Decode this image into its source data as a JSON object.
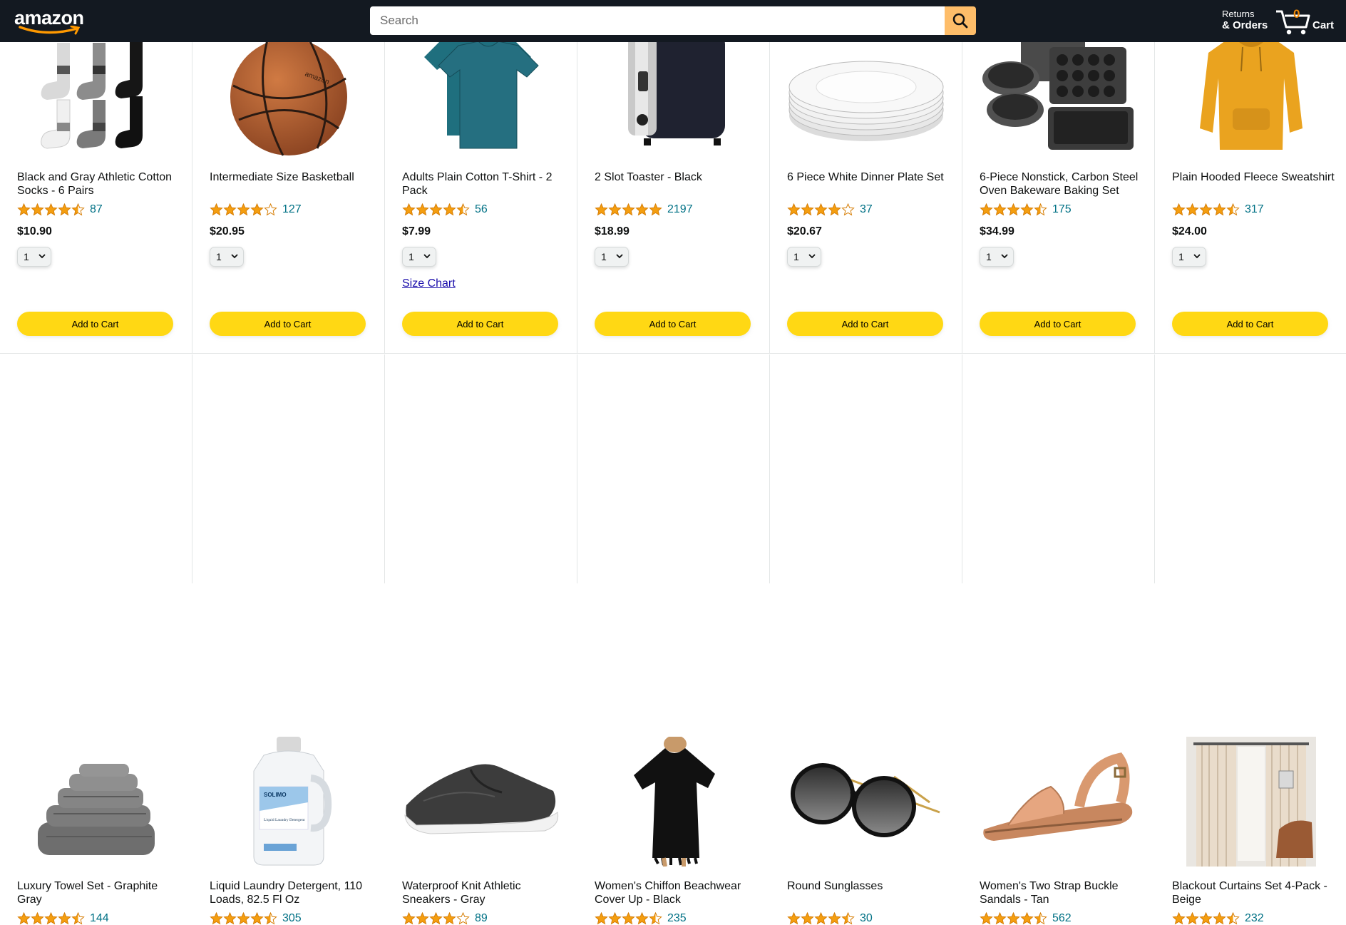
{
  "header": {
    "logo_text": "amazon",
    "search_placeholder": "Search",
    "returns_line1": "Returns",
    "returns_line2": "& Orders",
    "cart_count": "0",
    "cart_label": "Cart"
  },
  "colors": {
    "header_bg": "#131921",
    "search_button": "#febd69",
    "add_to_cart": "#ffd814",
    "star": "#f49e10",
    "link": "#007185"
  },
  "products": [
    {
      "name": "Black and Gray Athletic Cotton Socks - 6 Pairs",
      "rating": 4.5,
      "count": "87",
      "price": "$10.90",
      "qty": "1",
      "button": "Add to Cart",
      "image": "socks"
    },
    {
      "name": "Intermediate Size Basketball",
      "rating": 4.0,
      "count": "127",
      "price": "$20.95",
      "qty": "1",
      "button": "Add to Cart",
      "image": "basketball"
    },
    {
      "name": "Adults Plain Cotton T-Shirt - 2 Pack",
      "rating": 4.5,
      "count": "56",
      "price": "$7.99",
      "qty": "1",
      "button": "Add to Cart",
      "link": "Size Chart",
      "image": "tshirt"
    },
    {
      "name": "2 Slot Toaster - Black",
      "rating": 5.0,
      "count": "2197",
      "price": "$18.99",
      "qty": "1",
      "button": "Add to Cart",
      "image": "toaster"
    },
    {
      "name": "6 Piece White Dinner Plate Set",
      "rating": 4.0,
      "count": "37",
      "price": "$20.67",
      "qty": "1",
      "button": "Add to Cart",
      "image": "plates"
    },
    {
      "name": "6-Piece Nonstick, Carbon Steel Oven Bakeware Baking Set",
      "rating": 4.5,
      "count": "175",
      "price": "$34.99",
      "qty": "1",
      "button": "Add to Cart",
      "image": "bakeware"
    },
    {
      "name": "Plain Hooded Fleece Sweatshirt",
      "rating": 4.5,
      "count": "317",
      "price": "$24.00",
      "qty": "1",
      "button": "Add to Cart",
      "image": "hoodie"
    },
    {
      "name": "Luxury Towel Set - Graphite Gray",
      "rating": 4.5,
      "count": "144",
      "image": "towels"
    },
    {
      "name": "Liquid Laundry Detergent, 110 Loads, 82.5 Fl Oz",
      "rating": 4.5,
      "count": "305",
      "image": "detergent",
      "label_brand": "SOLIMO",
      "label_text": "Liquid Laundry Detergent"
    },
    {
      "name": "Waterproof Knit Athletic Sneakers - Gray",
      "rating": 4.0,
      "count": "89",
      "image": "sneaker"
    },
    {
      "name": "Women's Chiffon Beachwear Cover Up - Black",
      "rating": 4.5,
      "count": "235",
      "image": "coverup"
    },
    {
      "name": "Round Sunglasses",
      "rating": 4.5,
      "count": "30",
      "image": "sunglasses"
    },
    {
      "name": "Women's Two Strap Buckle Sandals - Tan",
      "rating": 4.5,
      "count": "562",
      "image": "sandals"
    },
    {
      "name": "Blackout Curtains Set 4-Pack - Beige",
      "rating": 4.5,
      "count": "232",
      "image": "curtains"
    }
  ]
}
